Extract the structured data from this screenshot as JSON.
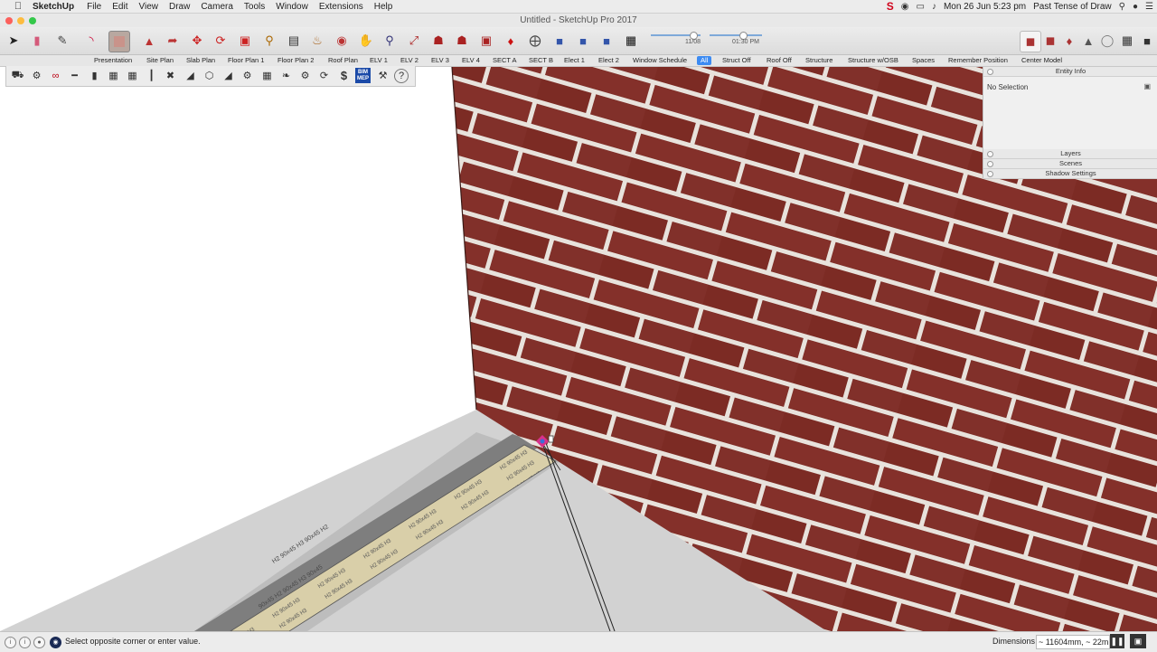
{
  "menubar": {
    "app_name": "SketchUp",
    "items": [
      "File",
      "Edit",
      "View",
      "Draw",
      "Camera",
      "Tools",
      "Window",
      "Extensions",
      "Help"
    ],
    "datetime": "Mon 26 Jun  5:23 pm",
    "user": "Past Tense of Draw"
  },
  "window": {
    "title": "Untitled - SketchUp Pro 2017"
  },
  "shadow_controls": {
    "date_label": "11/08",
    "time_label": "01:30 PM"
  },
  "scene_tabs": [
    "Presentation",
    "Site Plan",
    "Slab Plan",
    "Floor Plan 1",
    "Floor Plan 2",
    "Roof Plan",
    "ELV 1",
    "ELV 2",
    "ELV 3",
    "ELV 4",
    "SECT A",
    "SECT B",
    "Elect 1",
    "Elect 2",
    "Window Schedule",
    "All",
    "Struct Off",
    "Roof Off",
    "Structure",
    "Structure w/OSB",
    "Spaces",
    "Remember Position",
    "Center Model"
  ],
  "active_scene": "All",
  "tray": {
    "entity_info_title": "Entity Info",
    "selection_text": "No Selection",
    "layers_title": "Layers",
    "scenes_title": "Scenes",
    "shadow_title": "Shadow Settings"
  },
  "ext_toolbar": {
    "bim_mep_label": "BIM\nMEP",
    "dollar_label": "$"
  },
  "slab_labels": {
    "line1": "H2  90x45  H3  90x45  H2",
    "line2": "90x45 H2 90x45 H3 90x45"
  },
  "statusbar": {
    "prompt": "Select opposite corner or enter value.",
    "measurement_label": "Dimensions",
    "measurement_value": "~ 11604mm, ~ 22mm"
  },
  "colors": {
    "brick": "#7a2a22",
    "mortar": "#e8e2dc",
    "floor": "#cfcfcf",
    "active_tab": "#3d8bf2"
  }
}
